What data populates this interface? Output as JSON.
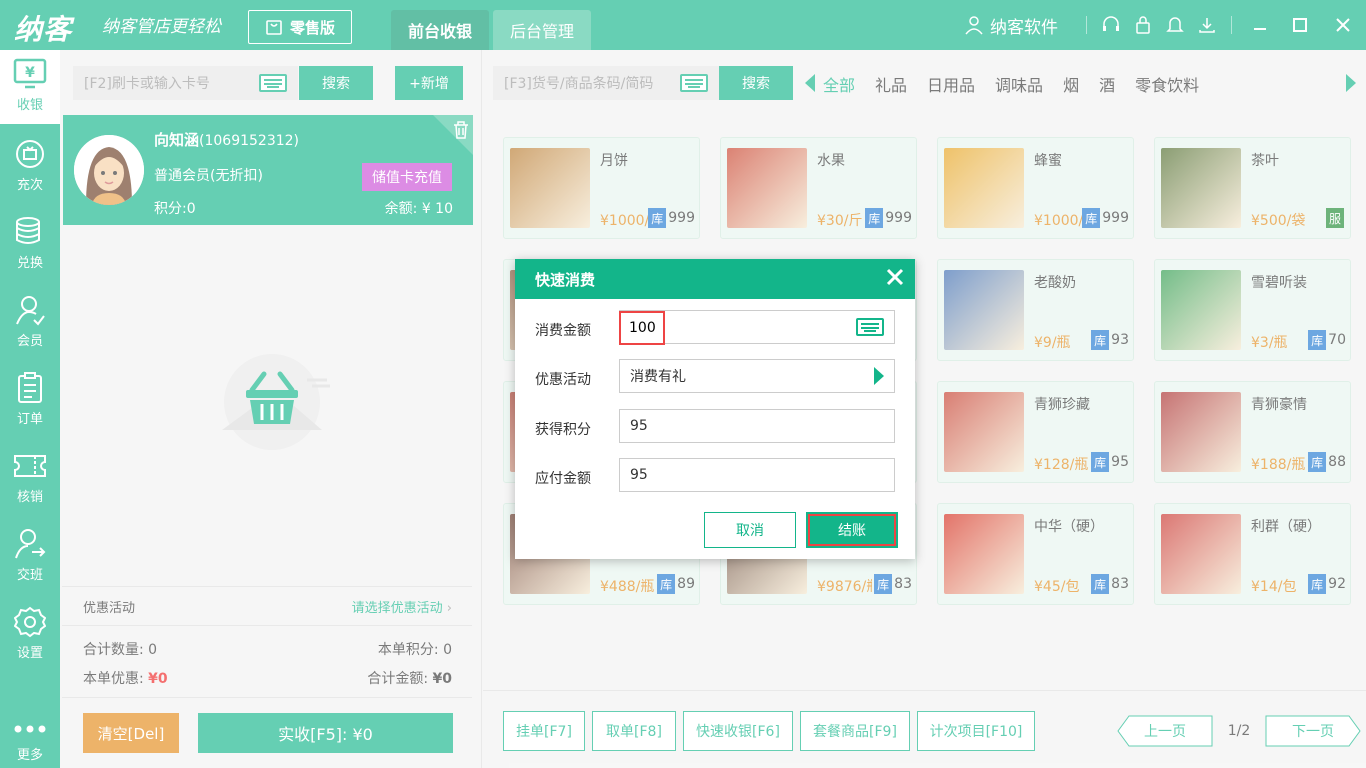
{
  "topbar": {
    "logo": "纳客",
    "slogan": "纳客管店更轻松",
    "edition": "零售版",
    "tabs": [
      "前台收银",
      "后台管理"
    ],
    "brand": "纳客软件"
  },
  "sidebar": {
    "items": [
      {
        "label": "收银",
        "icon": "monitor-yen-icon"
      },
      {
        "label": "充次",
        "icon": "recharge-icon"
      },
      {
        "label": "兑换",
        "icon": "database-icon"
      },
      {
        "label": "会员",
        "icon": "user-icon"
      },
      {
        "label": "订单",
        "icon": "clipboard-icon"
      },
      {
        "label": "核销",
        "icon": "ticket-icon"
      },
      {
        "label": "交班",
        "icon": "handover-icon"
      },
      {
        "label": "设置",
        "icon": "gear-icon"
      },
      {
        "label": "更多",
        "icon": "more-icon"
      }
    ]
  },
  "left": {
    "card_placeholder": "[F2]刷卡或输入卡号",
    "search_label": "搜索",
    "add_label": "+新增",
    "member": {
      "name": "向知涵",
      "id": "(1069152312)",
      "level": "普通会员(无折扣)",
      "points": "积分:0",
      "balance": "余额: ¥ 10",
      "recharge_label": "储值卡充值"
    },
    "promo_label": "优惠活动",
    "promo_link": "请选择优惠活动",
    "total_qty": "合计数量:  0",
    "order_points": "本单积分:  0",
    "discount_label": "本单优惠:",
    "discount_value": "¥0",
    "total_label": "合计金额:",
    "total_value": "¥0",
    "clear_label": "清空[Del]",
    "pay_label": "实收[F5]:  ¥0"
  },
  "main": {
    "goods_placeholder": "[F3]货号/商品条码/简码",
    "search_label": "搜索",
    "categories": [
      "全部",
      "礼品",
      "日用品",
      "调味品",
      "烟",
      "酒",
      "零食饮料"
    ],
    "products": [
      {
        "name": "月饼",
        "price": "¥1000/盒",
        "stock": "999",
        "badge": "库",
        "color": "#b87a2e"
      },
      {
        "name": "水果",
        "price": "¥30/斤",
        "stock": "999",
        "badge": "库",
        "color": "#c8402a"
      },
      {
        "name": "蜂蜜",
        "price": "¥1000/瓶",
        "stock": "999",
        "badge": "库",
        "color": "#e6a21a"
      },
      {
        "name": "茶叶",
        "price": "¥500/袋",
        "stock": "",
        "badge": "服",
        "color": "#4d6a2a"
      },
      {
        "name": "",
        "price": "",
        "stock": "",
        "badge": "",
        "color": "#8a5a3a"
      },
      {
        "name": "",
        "price": "",
        "stock": "",
        "badge": "",
        "color": "#9a9a9a"
      },
      {
        "name": "老酸奶",
        "price": "¥9/瓶",
        "stock": "93",
        "badge": "库",
        "color": "#3a6bb0"
      },
      {
        "name": "雪碧听装",
        "price": "¥3/瓶",
        "stock": "70",
        "badge": "库",
        "color": "#2a9a4a"
      },
      {
        "name": "",
        "price": "",
        "stock": "",
        "badge": "",
        "color": "#aa3a2a"
      },
      {
        "name": "",
        "price": "",
        "stock": "",
        "badge": "",
        "color": "#aa3a2a"
      },
      {
        "name": "青狮珍藏",
        "price": "¥128/瓶",
        "stock": "95",
        "badge": "库",
        "color": "#c43a2a"
      },
      {
        "name": "青狮豪情",
        "price": "¥188/瓶",
        "stock": "88",
        "badge": "库",
        "color": "#a82a2a"
      },
      {
        "name": "",
        "price": "¥488/瓶",
        "stock": "89",
        "badge": "库",
        "color": "#6a3a2a"
      },
      {
        "name": "",
        "price": "¥9876/瓶",
        "stock": "83",
        "badge": "库",
        "color": "#5a3a2a"
      },
      {
        "name": "中华（硬）",
        "price": "¥45/包",
        "stock": "83",
        "badge": "库",
        "color": "#d42a1a"
      },
      {
        "name": "利群（硬）",
        "price": "¥14/包",
        "stock": "92",
        "badge": "库",
        "color": "#c8302a"
      }
    ],
    "bottom_buttons": [
      "挂单[F7]",
      "取单[F8]",
      "快速收银[F6]",
      "套餐商品[F9]",
      "计次项目[F10]"
    ],
    "prev_page": "上一页",
    "next_page": "下一页",
    "page_info": "1/2"
  },
  "dialog": {
    "title": "快速消费",
    "amount_label": "消费金额",
    "amount_value": "100",
    "promo_label": "优惠活动",
    "promo_value": "消费有礼",
    "points_label": "获得积分",
    "points_value": "95",
    "payable_label": "应付金额",
    "payable_value": "95",
    "cancel_label": "取消",
    "checkout_label": "结账"
  }
}
